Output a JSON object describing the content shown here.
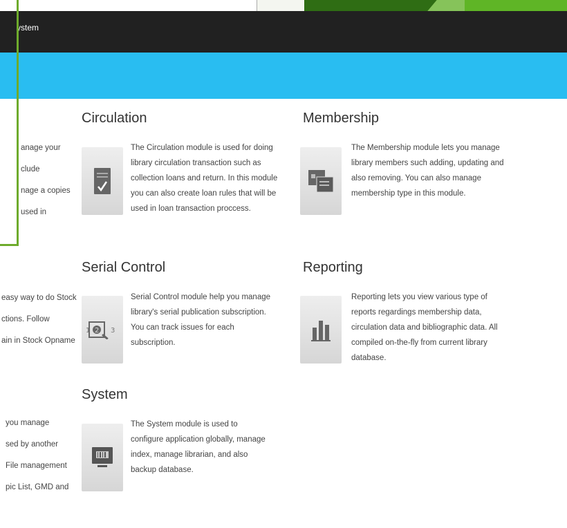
{
  "app": {
    "title": "ystem"
  },
  "modules": {
    "circulation": {
      "title": "Circulation",
      "desc": "The Circulation module is used for doing library circulation transaction such as collection loans and return. In this module you can also create loan rules that will be used in loan transaction proccess."
    },
    "membership": {
      "title": "Membership",
      "desc": "The Membership module lets you manage library members such adding, updating and also removing. You can also manage membership type in this module."
    },
    "serial_control": {
      "title": "Serial Control",
      "desc": "Serial Control module help you manage library's serial publication subscription. You can track issues for each subscription."
    },
    "reporting": {
      "title": "Reporting",
      "desc": "Reporting lets you view various type of reports regardings membership data, circulation data and bibliographic data. All compiled on-the-fly from current library database."
    },
    "system": {
      "title": "System",
      "desc": "The System module is used to configure application globally, manage index, manage librarian, and also backup database."
    }
  },
  "left_cutoff": {
    "lines_a": [
      "anage your",
      "clude",
      "nage a copies",
      "used in"
    ],
    "lines_b": [
      "easy way to do Stock",
      "ctions. Follow",
      "ain in Stock Opname"
    ],
    "lines_c": [
      "you manage",
      "sed by another",
      "File management",
      "pic List, GMD and"
    ]
  },
  "colors": {
    "header_dark": "#212121",
    "header_blue": "#29bdf1",
    "accent_green": "#6eab2c"
  }
}
